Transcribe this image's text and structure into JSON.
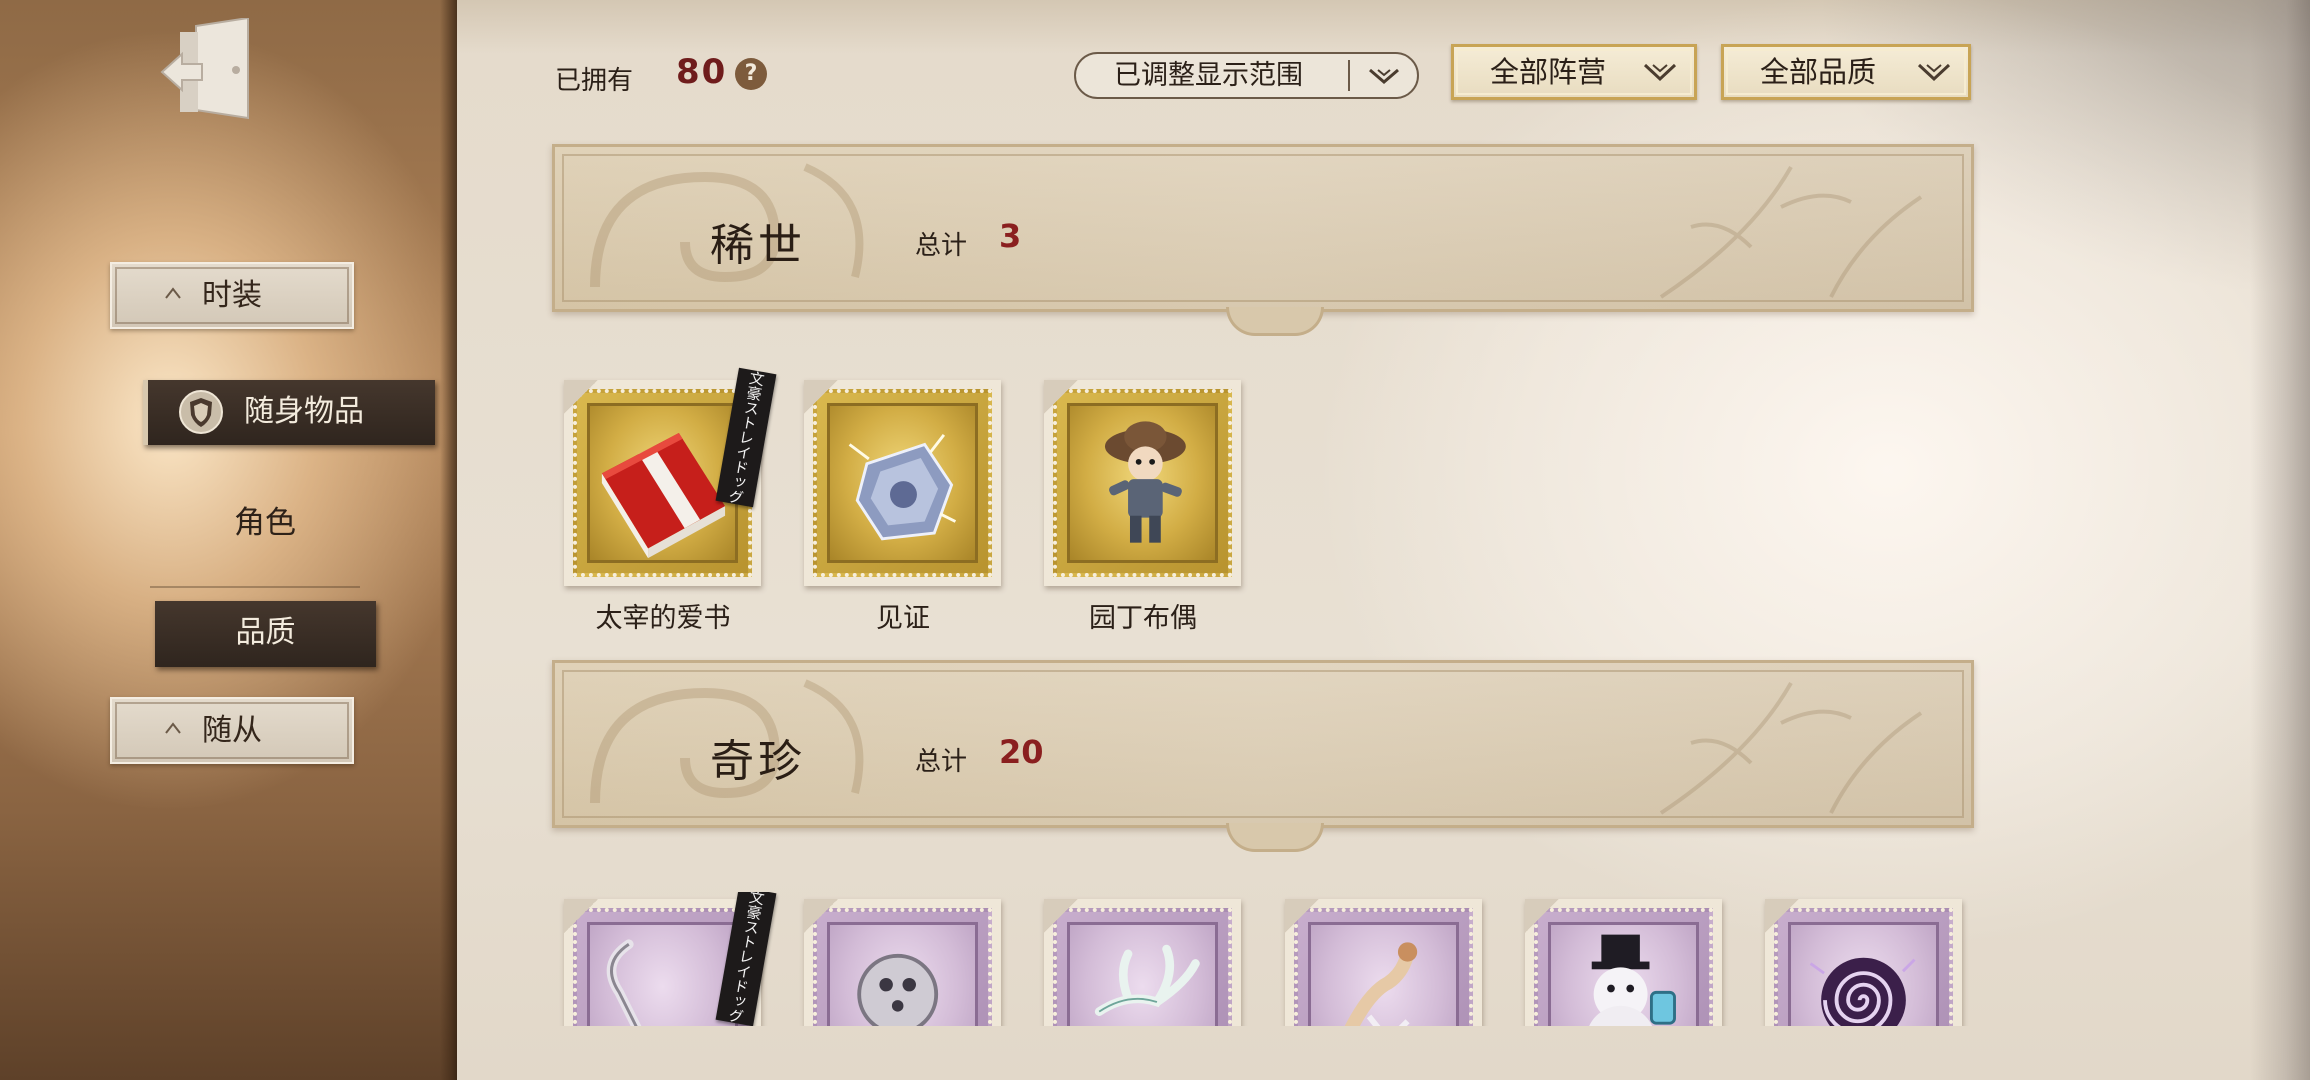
{
  "nav": {
    "exit_icon": "exit-door-icon"
  },
  "sidebar": {
    "items": [
      {
        "label": "时装"
      },
      {
        "label": "随身物品",
        "icon": "shield-icon"
      },
      {
        "label": "角色"
      },
      {
        "label": "品质"
      },
      {
        "label": "随从"
      }
    ]
  },
  "header": {
    "owned_label": "已拥有",
    "owned_count": "80",
    "help_icon": "question-icon",
    "help_glyph": "?",
    "filters": [
      {
        "label": "已调整显示范围",
        "icon": "chevron-down-icon"
      },
      {
        "label": "全部阵营",
        "icon": "chevron-down-icon"
      },
      {
        "label": "全部品质",
        "icon": "chevron-down-icon"
      }
    ]
  },
  "sections": [
    {
      "title": "稀世",
      "total_label": "总计",
      "total": "3",
      "frame_color": "#c9a640",
      "items": [
        {
          "name": "太宰的爱书",
          "badge": "文豪ストレイドッグス",
          "icon": "red-book-icon"
        },
        {
          "name": "见证",
          "icon": "silver-crystal-icon"
        },
        {
          "name": "园丁布偶",
          "icon": "gardener-doll-icon"
        }
      ]
    },
    {
      "title": "奇珍",
      "total_label": "总计",
      "total": "20",
      "frame_color": "#b9a0c0",
      "items": [
        {
          "badge": "文豪ストレイドッグス",
          "icon": "silver-hook-icon"
        },
        {
          "icon": "silver-medallion-icon"
        },
        {
          "icon": "antler-icon"
        },
        {
          "icon": "hand-figure-icon"
        },
        {
          "icon": "snowman-tophat-icon"
        },
        {
          "icon": "purple-spiral-icon"
        }
      ]
    }
  ]
}
